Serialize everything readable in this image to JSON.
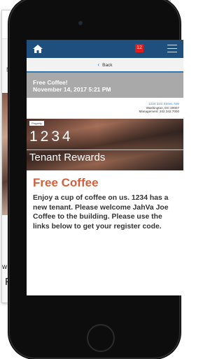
{
  "background": {
    "left_letter_m": "M",
    "left_letter_w": "w",
    "left_letter_p": "P"
  },
  "app": {
    "notifications_count": "12",
    "back_label": "Back",
    "title_line1": "Free Coffee!",
    "title_line2": "November 14, 2017 5:21 PM"
  },
  "address": {
    "street": "1234 31st Street, NW",
    "city": "Washington, DC 20007",
    "management": "Management: 202.342.7000"
  },
  "banner": {
    "tag": "Property",
    "number": "1234",
    "label": "Tenant Rewards"
  },
  "post": {
    "headline": "Free Coffee",
    "body": "Enjoy a cup of coffee on us. 1234 has a new tenant. Please welcome JahVa Joe Coffee to the building. Please use the links below to get your register code."
  },
  "colors": {
    "appbar": "#1e4f7d",
    "accent": "#2f78b7",
    "badge": "#e21b1b",
    "headline": "#d1603d",
    "titlebar": "#a9a9a9"
  }
}
